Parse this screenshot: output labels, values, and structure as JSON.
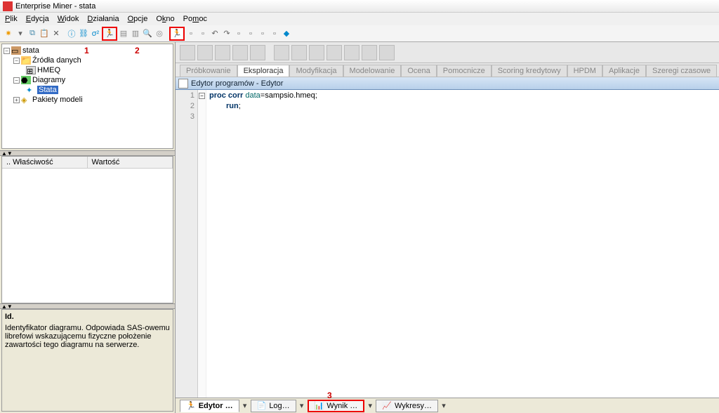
{
  "title": "Enterprise Miner - stata",
  "menu": {
    "file": "Plik",
    "edit": "Edycja",
    "view": "Widok",
    "actions": "Działania",
    "options": "Opcje",
    "window": "Okno",
    "help": "Pomoc"
  },
  "tree": {
    "root": "stata",
    "sources_label": "Źródła danych",
    "source_1": "HMEQ",
    "diagrams_label": "Diagramy",
    "diagram_1": "Stata",
    "models_label": "Pakiety modeli"
  },
  "props": {
    "col1": ".. Właściwość",
    "col2": "Wartość"
  },
  "desc": {
    "title": "Id.",
    "body": "Identyfikator diagramu. Odpowiada SAS-owemu librefowi wskazującemu fizyczne położenie zawartości tego diagramu na serwerze."
  },
  "nodetabs": {
    "sampling": "Próbkowanie",
    "explore": "Eksploracja",
    "modify": "Modyfikacja",
    "model": "Modelowanie",
    "assess": "Ocena",
    "utility": "Pomocnicze",
    "credit": "Scoring kredytowy",
    "hpdm": "HPDM",
    "apps": "Aplikacje",
    "timeseries": "Szeregi czasowe"
  },
  "editor": {
    "title": "Edytor programów - Edytor",
    "code": {
      "l1_proc": "proc ",
      "l1_corr": "corr",
      "l1_data": " data",
      "l1_eq": "=sampsio.hmeq;",
      "l2": "run",
      "l2_semi": ";"
    }
  },
  "bottom": {
    "editor": "Edytor …",
    "log": "Log…",
    "output": "Wynik …",
    "charts": "Wykresy…"
  },
  "annot": {
    "a1": "1",
    "a2": "2",
    "a3": "3"
  }
}
